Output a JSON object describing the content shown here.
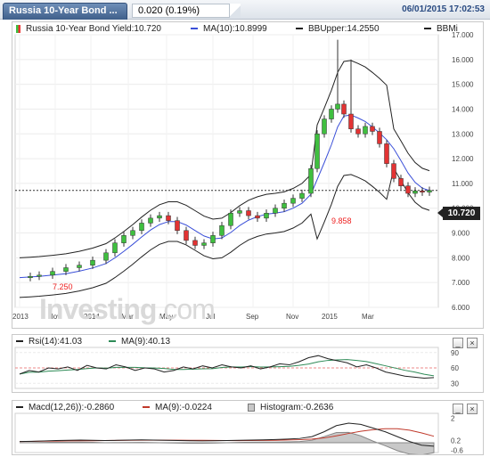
{
  "header": {
    "title": "Russia 10-Year Bond ...",
    "price_change": "0.020 (0.19%)",
    "datetime": "06/01/2015 17:02:53"
  },
  "main_legend": {
    "instrument": "Russia 10-Year Bond Yield:10.720",
    "ma": "MA(10):10.8999",
    "bbupper": "BBUpper:14.2550",
    "bbmid": "BBMi"
  },
  "main_chart": {
    "y_ticks": [
      "17.000",
      "16.000",
      "15.000",
      "14.000",
      "13.000",
      "12.000",
      "11.000",
      "10.000",
      "9.000",
      "8.000",
      "7.000",
      "6.000"
    ],
    "x_ticks": [
      "2013",
      "Nov",
      "2014",
      "Mar",
      "May",
      "Jul",
      "Sep",
      "Nov",
      "2015",
      "Mar"
    ],
    "last_price": "10.720",
    "annotation_high": "9.858",
    "annotation_low": "7.250",
    "watermark_a": "Investing",
    "watermark_b": ".com"
  },
  "rsi_legend": {
    "rsi": "Rsi(14):41.03",
    "ma": "MA(9):40.13"
  },
  "rsi_chart": {
    "y_ticks": [
      "90",
      "60",
      "30"
    ]
  },
  "macd_legend": {
    "macd": "Macd(12,26)):-0.2860",
    "ma": "MA(9):-0.0224",
    "histogram": "Histogram:-0.2636"
  },
  "macd_chart": {
    "y_ticks": [
      "2",
      "0.2",
      "-0.6"
    ]
  },
  "buttons": {
    "minimize": "_",
    "close": "×"
  },
  "colors": {
    "up": "#3fbf3f",
    "down": "#e33333",
    "ma_line": "#3a4fd8",
    "bb_line": "#222222",
    "rsi_ma": "#2e8b57"
  },
  "chart_data": {
    "type": "candlestick",
    "title": "Russia 10-Year Bond Yield",
    "x_labels": [
      "2013",
      "Nov",
      "2014",
      "Mar",
      "May",
      "Jul",
      "Sep",
      "Nov",
      "2015",
      "Mar"
    ],
    "ylim": [
      6.0,
      17.0
    ],
    "series": [
      {
        "name": "Russia 10-Year Bond Yield",
        "last": 10.72
      },
      {
        "name": "MA(10)",
        "last": 10.8999
      },
      {
        "name": "BBUpper",
        "last": 14.255
      }
    ]
  }
}
